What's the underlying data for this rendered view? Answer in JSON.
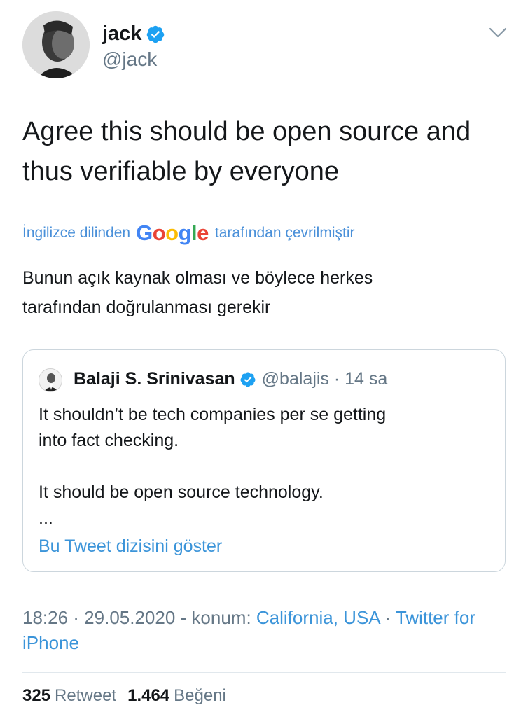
{
  "author": {
    "display_name": "jack",
    "handle": "@jack"
  },
  "tweet": {
    "text_line_1": "Agree this should be open source and",
    "text_line_2": "thus verifiable by everyone"
  },
  "translation": {
    "prefix": "İngilizce dilinden",
    "provider_letters": [
      "G",
      "o",
      "o",
      "g",
      "l",
      "e"
    ],
    "suffix": "tarafından çevrilmiştir",
    "line_1": "Bunun açık kaynak olması ve böylece herkes",
    "line_2": "tarafından doğrulanması gerekir"
  },
  "quoted_tweet": {
    "display_name": "Balaji S. Srinivasan",
    "handle_time": "@balajis · 14 sa",
    "line_1": "It shouldn’t be tech companies per se getting",
    "line_2": "into fact checking.",
    "line_3": "It should be open source technology.",
    "line_4": "...",
    "show_thread": "Bu Tweet dizisini göster"
  },
  "meta": {
    "time_date": "18:26 · 29.05.2020 - konum: ",
    "location": "California, USA",
    "separator": " · ",
    "source": "Twitter for iPhone"
  },
  "stats": {
    "retweets_count": "325",
    "retweets_label": "Retweet",
    "likes_count": "1.464",
    "likes_label": "Beğeni"
  },
  "colors": {
    "link": "#3b94d9",
    "verified": "#1da1f2",
    "secondary_text": "#657786"
  },
  "icons": {
    "verified": "verified-badge-icon",
    "menu": "chevron-down-icon"
  }
}
